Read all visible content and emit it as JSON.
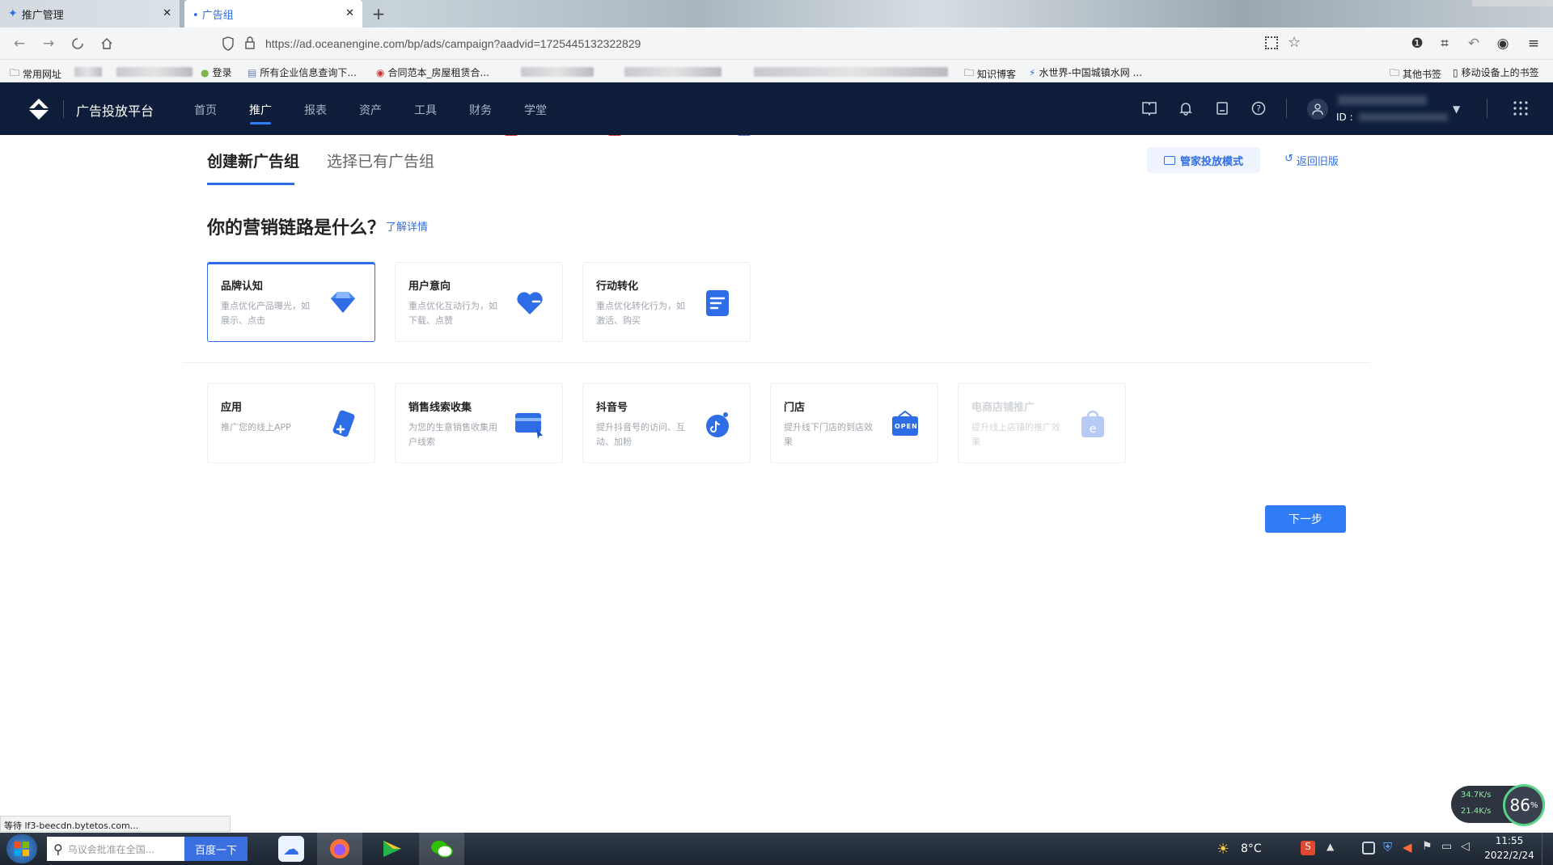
{
  "browser": {
    "tabs": [
      {
        "label": "推广管理"
      },
      {
        "label": "• 广告组"
      }
    ],
    "new_tab": "+",
    "url": "https://ad.oceanengine.com/bp/ads/campaign?aadvid=1725445132322829",
    "bookmarks": [
      "常用网址",
      "登录",
      "所有企业信息查询下...",
      "合同范本_房屋租赁合...",
      "知识博客",
      "水世界-中国城镇水网 ...",
      "其他书签",
      "移动设备上的书签"
    ]
  },
  "app": {
    "brand": "广告投放平台",
    "menu": [
      "首页",
      "推广",
      "报表",
      "资产",
      "工具",
      "财务",
      "学堂"
    ],
    "active_menu": "推广",
    "user_id_label": "ID :"
  },
  "content": {
    "tabs": [
      "创建新广告组",
      "选择已有广告组"
    ],
    "butler_mode": "管家投放模式",
    "back_old": "返回旧版",
    "question": "你的营销链路是什么？",
    "learn_more": "了解详情",
    "goals": [
      {
        "title": "品牌认知",
        "desc": "重点优化产品曝光，如展示、点击",
        "icon": "diamond-icon",
        "selected": true
      },
      {
        "title": "用户意向",
        "desc": "重点优化互动行为，如下载、点赞",
        "icon": "heart-icon",
        "selected": false
      },
      {
        "title": "行动转化",
        "desc": "重点优化转化行为，如激活、购买",
        "icon": "document-icon",
        "selected": false
      }
    ],
    "types": [
      {
        "title": "应用",
        "desc": "推广您的线上APP",
        "icon": "app-plus-icon",
        "disabled": false
      },
      {
        "title": "销售线索收集",
        "desc": "为您的生意销售收集用户线索",
        "icon": "card-icon",
        "disabled": false
      },
      {
        "title": "抖音号",
        "desc": "提升抖音号的访问、互动、加粉",
        "icon": "douyin-icon",
        "disabled": false
      },
      {
        "title": "门店",
        "desc": "提升线下门店的到店效果",
        "icon": "open-sign-icon",
        "open_text": "OPEN",
        "disabled": false
      },
      {
        "title": "电商店铺推广",
        "desc": "提升线上店铺的推广效果",
        "icon": "shop-bag-icon",
        "disabled": true
      }
    ],
    "next": "下一步"
  },
  "system": {
    "status_text": "等待 lf3-beecdn.bytetos.com...",
    "search_placeholder": "乌议会批准在全国...",
    "baidu_button": "百度一下",
    "weather": "8°C",
    "time": "11:55",
    "date": "2022/2/24",
    "net_up": "34.7K/s",
    "net_down": "21.4K/s",
    "cpu": "86",
    "cpu_unit": "%"
  },
  "colors": {
    "header_bg": "#0e1e3a",
    "accent": "#2e6de6",
    "next_bg": "#2f7cf6"
  }
}
